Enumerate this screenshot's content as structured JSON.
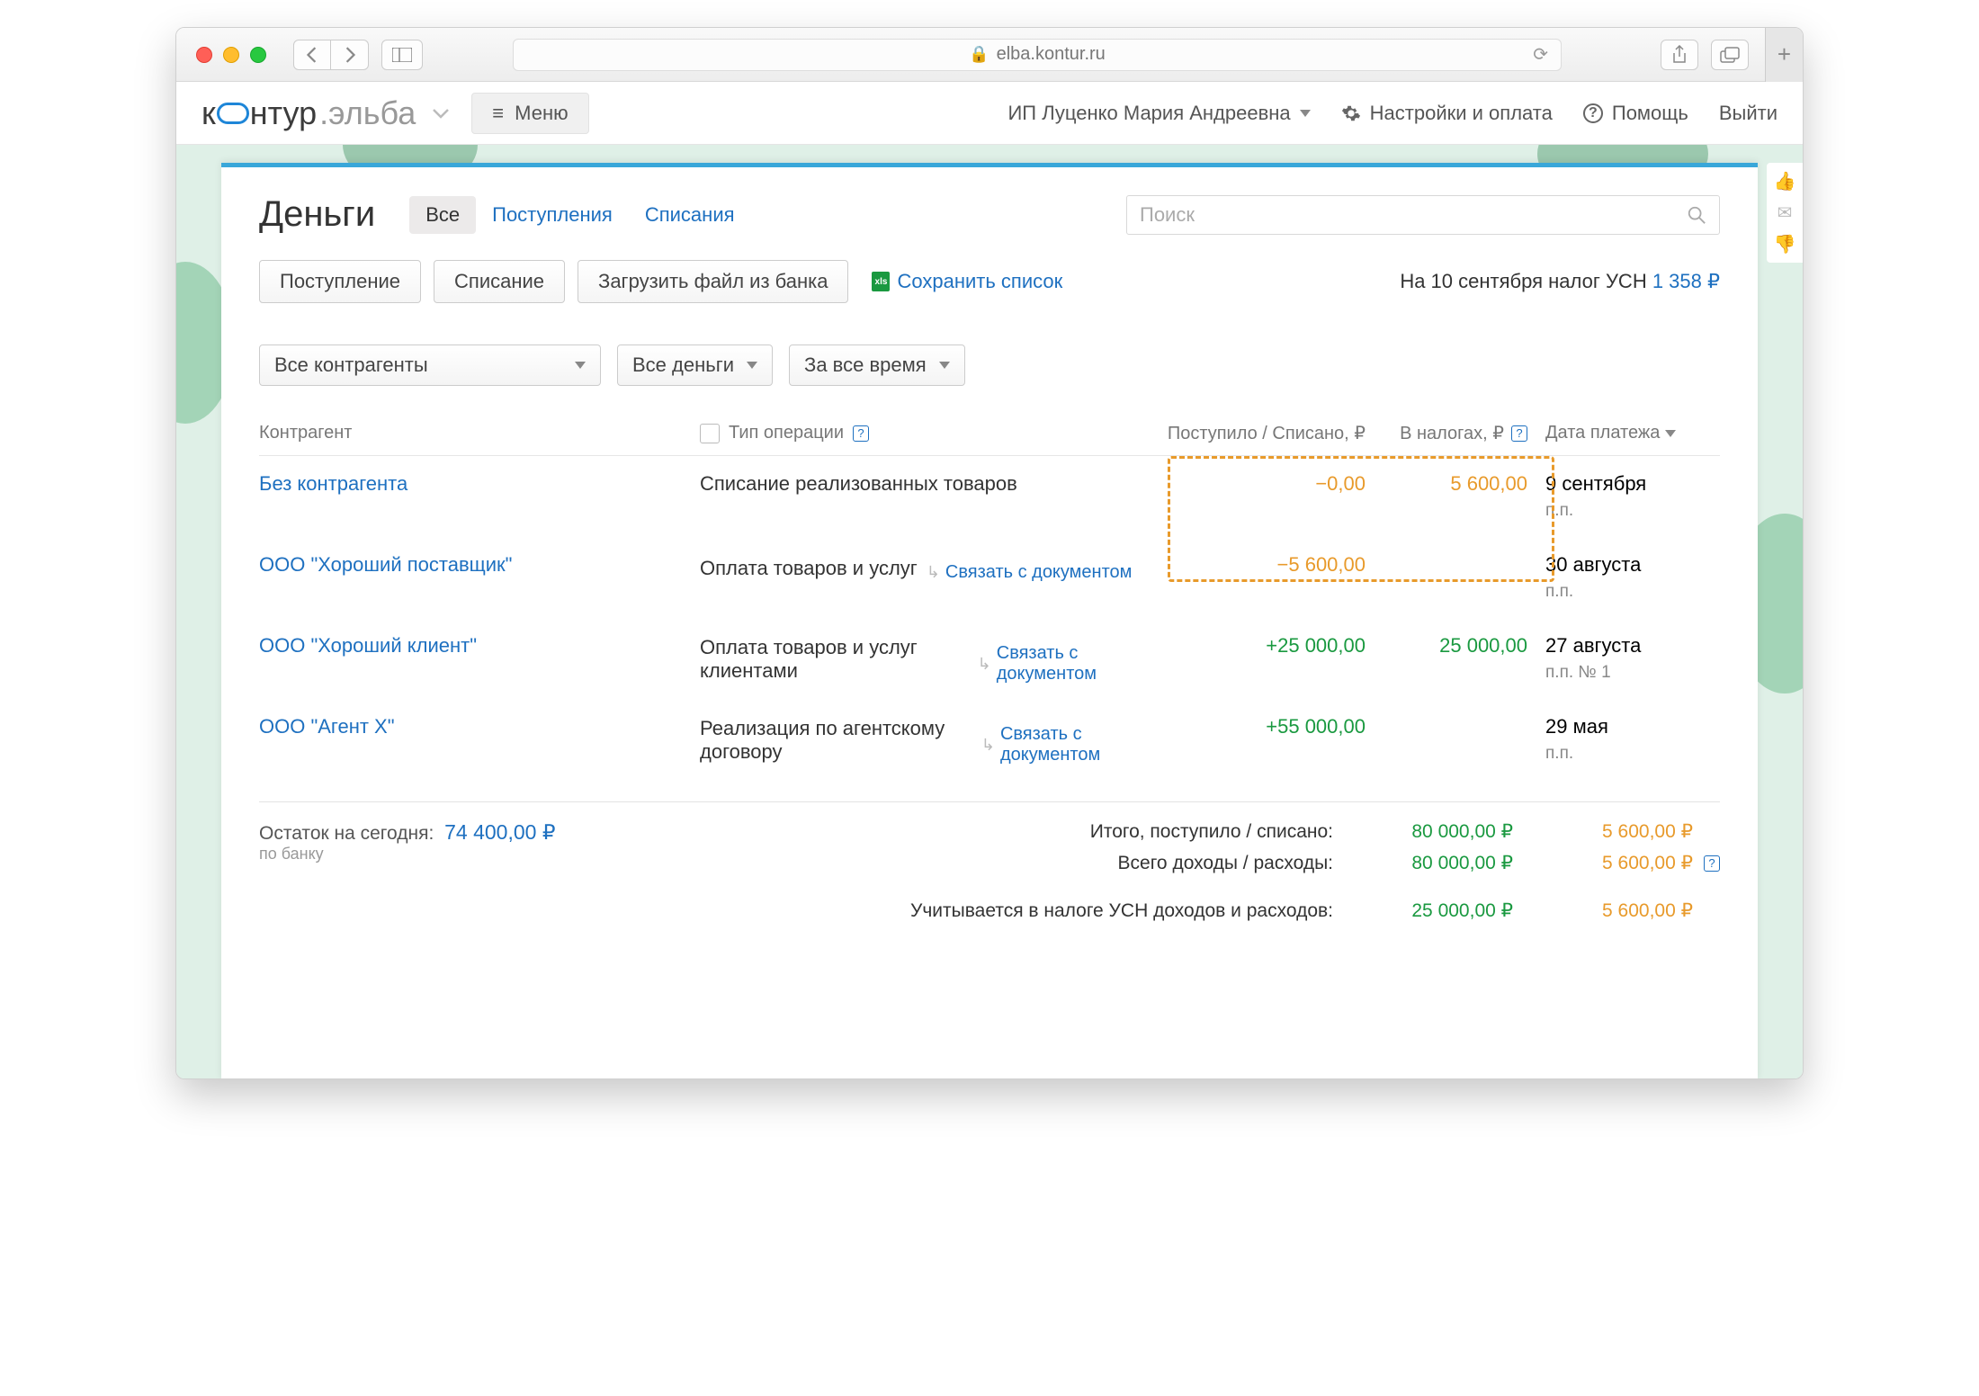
{
  "browser": {
    "url": "elba.kontur.ru"
  },
  "topnav": {
    "logo_part1": "к",
    "logo_part2": "нтур",
    "logo_part3": ".эльба",
    "menu": "Меню",
    "user": "ИП Луценко Мария Андреевна",
    "settings": "Настройки и оплата",
    "help": "Помощь",
    "logout": "Выйти"
  },
  "page": {
    "title": "Деньги",
    "tabs": {
      "all": "Все",
      "income": "Поступления",
      "expense": "Списания"
    },
    "search_placeholder": "Поиск",
    "actions": {
      "income": "Поступление",
      "expense": "Списание",
      "upload": "Загрузить файл из банка",
      "save_list": "Сохранить список"
    },
    "tax_note_prefix": "На 10 сентября налог УСН ",
    "tax_note_amount": "1 358 ₽",
    "filters": {
      "counterparty": "Все контрагенты",
      "money": "Все деньги",
      "period": "За все время"
    },
    "columns": {
      "agent": "Контрагент",
      "op": "Тип операции",
      "amount": "Поступило / Списано, ₽",
      "tax": "В налогах, ₽",
      "date": "Дата платежа"
    },
    "rows": [
      {
        "agent": "Без контрагента",
        "op": "Списание реализованных товаров",
        "link": "",
        "amount": "−0,00",
        "amount_class": "neg",
        "tax": "5 600,00",
        "tax_class": "neg",
        "date": "9 сентября",
        "date_sub": "п.п."
      },
      {
        "agent": "ООО \"Хороший поставщик\"",
        "op": "Оплата товаров и услуг",
        "link": "Связать с документом",
        "amount": "−5 600,00",
        "amount_class": "neg",
        "tax": "",
        "tax_class": "",
        "date": "30 августа",
        "date_sub": "п.п."
      },
      {
        "agent": "ООО \"Хороший клиент\"",
        "op": "Оплата товаров и услуг клиентами",
        "link": "Связать с документом",
        "amount": "+25 000,00",
        "amount_class": "pos",
        "tax": "25 000,00",
        "tax_class": "pos",
        "date": "27 августа",
        "date_sub": "п.п. № 1"
      },
      {
        "agent": "ООО \"Агент Х\"",
        "op": "Реализация по агентскому договору",
        "link": "Связать с документом",
        "amount": "+55 000,00",
        "amount_class": "pos",
        "tax": "",
        "tax_class": "",
        "date": "29 мая",
        "date_sub": "п.п."
      }
    ],
    "summary": {
      "balance_label": "Остаток на сегодня:",
      "balance_amount": "74 400,00 ₽",
      "balance_sub": "по банку",
      "rows": [
        {
          "label": "Итого, поступило / списано:",
          "v1": "80 000,00 ₽",
          "v2": "5 600,00 ₽",
          "help": false
        },
        {
          "label": "Всего доходы / расходы:",
          "v1": "80 000,00 ₽",
          "v2": "5 600,00 ₽",
          "help": true
        },
        {
          "label": "Учитывается в налоге УСН доходов и расходов:",
          "v1": "25 000,00 ₽",
          "v2": "5 600,00 ₽",
          "help": false
        }
      ]
    }
  }
}
